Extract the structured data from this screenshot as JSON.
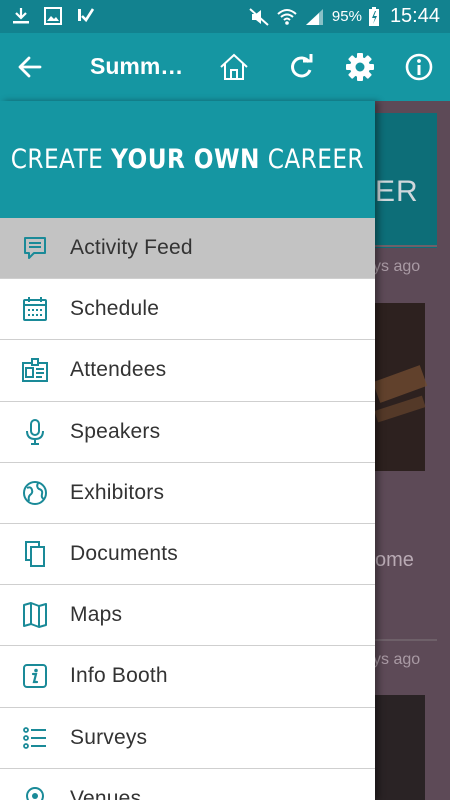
{
  "status_bar": {
    "battery": "95%",
    "time": "15:44"
  },
  "app_bar": {
    "title": "Summ…"
  },
  "drawer": {
    "tagline_prefix": "CREATE ",
    "tagline_bold": "YOUR OWN",
    "tagline_suffix": " CAREER",
    "items": [
      {
        "label": "Activity Feed",
        "icon": "activity-feed-icon",
        "active": true
      },
      {
        "label": "Schedule",
        "icon": "calendar-icon",
        "active": false
      },
      {
        "label": "Attendees",
        "icon": "attendees-icon",
        "active": false
      },
      {
        "label": "Speakers",
        "icon": "microphone-icon",
        "active": false
      },
      {
        "label": "Exhibitors",
        "icon": "globe-icon",
        "active": false
      },
      {
        "label": "Documents",
        "icon": "documents-icon",
        "active": false
      },
      {
        "label": "Maps",
        "icon": "map-icon",
        "active": false
      },
      {
        "label": "Info Booth",
        "icon": "info-icon",
        "active": false
      },
      {
        "label": "Surveys",
        "icon": "list-icon",
        "active": false
      },
      {
        "label": "Venues",
        "icon": "location-pin-icon",
        "active": false
      }
    ]
  },
  "background": {
    "banner_text": "ER",
    "card1_time": "ys ago",
    "card1_text": "ome",
    "card2_time": "ys ago"
  },
  "colors": {
    "status_bar": "#12828f",
    "app_bar": "#1596a2",
    "accent_icon": "#1a8a98",
    "active_item_bg": "#c3c3c3"
  }
}
